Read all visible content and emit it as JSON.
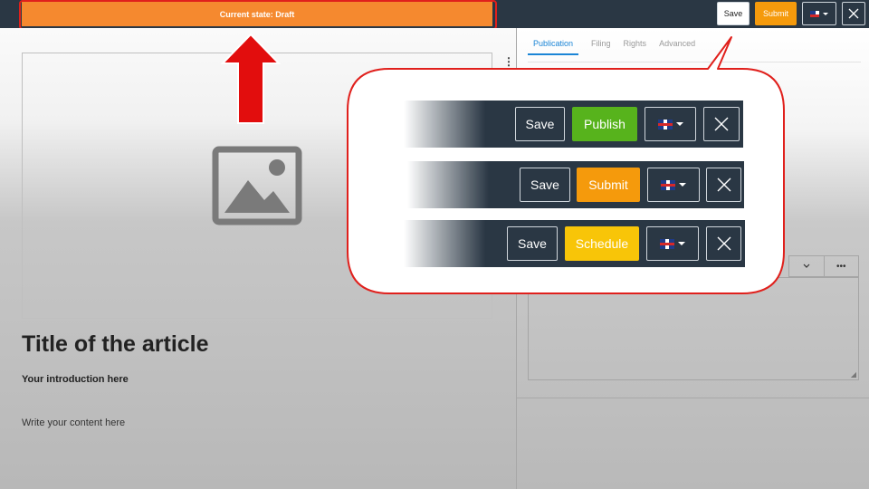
{
  "topbar": {
    "state_label": "Current state: Draft",
    "save_label": "Save",
    "submit_label": "Submit",
    "language_icon": "uk-flag-icon",
    "close_icon": "close-icon"
  },
  "editor": {
    "title": "Title of the article",
    "introduction": "Your introduction here",
    "content": "Write your content here",
    "image_icon": "image-placeholder-icon"
  },
  "sidepanel": {
    "tabs": [
      {
        "label": "Publication",
        "active": true
      },
      {
        "label": "Filing",
        "active": false
      },
      {
        "label": "Rights",
        "active": false
      },
      {
        "label": "Advanced",
        "active": false
      }
    ],
    "toolbar_more": "•••"
  },
  "callout": {
    "rows": [
      {
        "save": "Save",
        "action": "Publish",
        "action_color": "#57b31c"
      },
      {
        "save": "Save",
        "action": "Submit",
        "action_color": "#f59a0c"
      },
      {
        "save": "Save",
        "action": "Schedule",
        "action_color": "#f8c508"
      }
    ]
  },
  "colors": {
    "bar": "#2a3744",
    "draft_banner": "#f5892f",
    "highlight": "#e0201c"
  }
}
